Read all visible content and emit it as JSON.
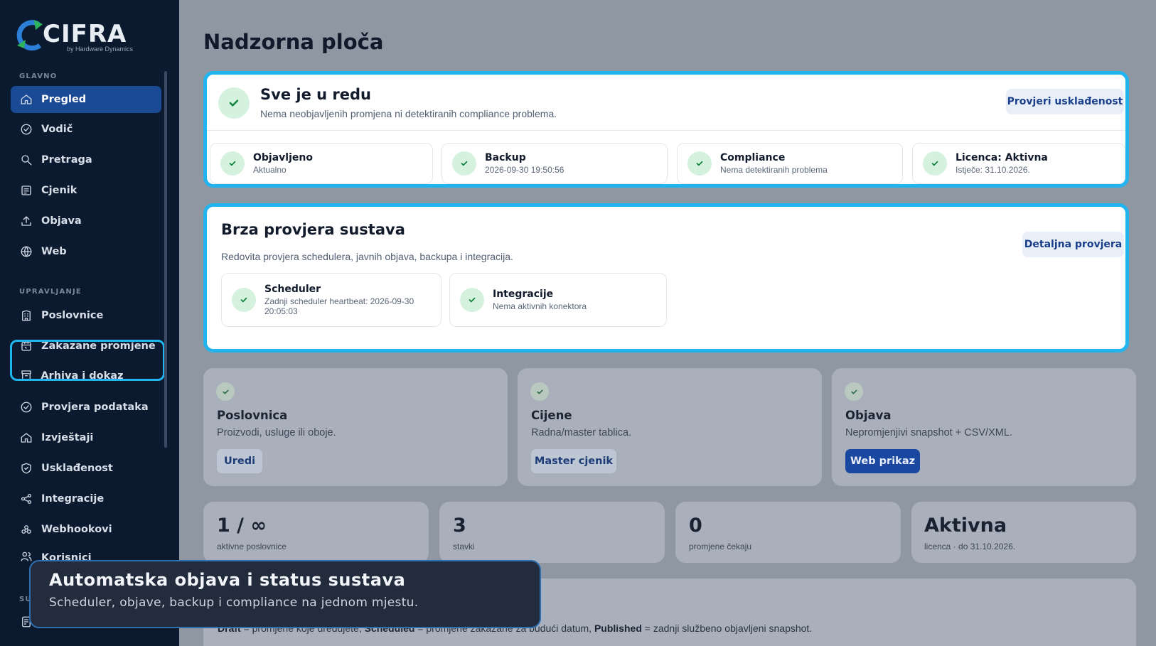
{
  "brand": {
    "name": "CIFRA",
    "tagline": "by Hardware Dynamics"
  },
  "sidebar": {
    "sections": [
      {
        "title": "GLAVNO"
      },
      {
        "title": "UPRAVLJANJE"
      },
      {
        "title": "SU"
      }
    ],
    "items": [
      {
        "label": "Pregled",
        "icon": "home-icon"
      },
      {
        "label": "Vodič",
        "icon": "check-circle-icon"
      },
      {
        "label": "Pretraga",
        "icon": "search-icon"
      },
      {
        "label": "Cjenik",
        "icon": "list-icon"
      },
      {
        "label": "Objava",
        "icon": "upload-icon"
      },
      {
        "label": "Web",
        "icon": "globe-icon"
      },
      {
        "label": "Poslovnice",
        "icon": "building-icon"
      },
      {
        "label": "Zakazane promjene",
        "icon": "calendar-icon"
      },
      {
        "label": "Arhiva i dokaz objave",
        "icon": "archive-icon"
      },
      {
        "label": "Provjera podataka",
        "icon": "check-circle-icon"
      },
      {
        "label": "Izvještaji",
        "icon": "home-icon"
      },
      {
        "label": "Usklađenost",
        "icon": "shield-icon"
      },
      {
        "label": "Integracije",
        "icon": "share-icon"
      },
      {
        "label": "Webhookovi",
        "icon": "webhook-icon"
      },
      {
        "label": "Korisnici",
        "icon": "users-icon"
      }
    ]
  },
  "main": {
    "title": "Nadzorna ploča",
    "status": {
      "title": "Sve je u redu",
      "subtitle": "Nema neobjavljenih promjena ni detektiranih compliance problema.",
      "button": "Provjeri usklađenost",
      "items": [
        {
          "title": "Objavljeno",
          "sub": "Aktualno"
        },
        {
          "title": "Backup",
          "sub": "2026-09-30 19:50:56"
        },
        {
          "title": "Compliance",
          "sub": "Nema detektiranih problema"
        },
        {
          "title": "Licenca: Aktivna",
          "sub": "Istječe: 31.10.2026."
        }
      ]
    },
    "quick": {
      "title": "Brza provjera sustava",
      "subtitle": "Redovita provjera schedulera, javnih objava, backupa i integracija.",
      "button": "Detaljna provjera",
      "items": [
        {
          "title": "Scheduler",
          "sub": "Zadnji scheduler heartbeat: 2026-09-30 20:05:03"
        },
        {
          "title": "Integracije",
          "sub": "Nema aktivnih konektora"
        }
      ]
    },
    "features": [
      {
        "title": "Poslovnica",
        "sub": "Proizvodi, usluge ili oboje.",
        "button": "Uredi"
      },
      {
        "title": "Cijene",
        "sub": "Radna/master tablica.",
        "button": "Master cjenik"
      },
      {
        "title": "Objava",
        "sub": "Nepromjenjivi snapshot + CSV/XML.",
        "button": "Web prikaz"
      }
    ],
    "stats": [
      {
        "value": "1 / ∞",
        "label": "aktivne poslovnice"
      },
      {
        "value": "3",
        "label": "stavki"
      },
      {
        "value": "0",
        "label": "promjene čekaju"
      },
      {
        "value": "Aktivna",
        "label": "licenca · do 31.10.2026."
      }
    ],
    "legend": {
      "draft": "Draft",
      "draft_text": " = promjene koje uređujete, ",
      "scheduled": "Scheduled",
      "scheduled_text": " = promjene zakazane za budući datum, ",
      "published": "Published",
      "published_text": " = zadnji službeno objavljeni snapshot."
    }
  },
  "toast": {
    "title": "Automatska objava i status sustava",
    "subtitle": "Scheduler, objave, backup i compliance na jednom mjestu."
  },
  "colors": {
    "accent": "#21b4ee",
    "sidebar": "#0c1a30",
    "active": "#1a4a94",
    "success": "#14803c"
  }
}
